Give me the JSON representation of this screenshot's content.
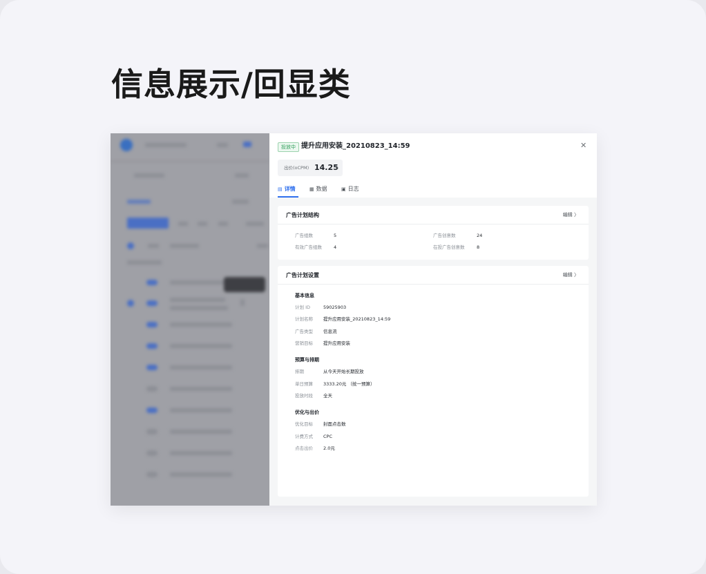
{
  "heading": "信息展示/回显类",
  "drawer": {
    "status_tag": "投放中",
    "title": "提升应用安装_20210823_14:59",
    "close_icon": "close-icon",
    "bid": {
      "label": "出价(oCPM)",
      "value": "14.25",
      "edit_icon": "pencil-icon"
    },
    "tabs": [
      {
        "label": "详情",
        "icon": "detail-icon",
        "active": true
      },
      {
        "label": "数据",
        "icon": "data-icon",
        "active": false
      },
      {
        "label": "日志",
        "icon": "log-icon",
        "active": false
      }
    ]
  },
  "structure": {
    "title": "广告计划结构",
    "edit_label": "编辑 〉",
    "items": [
      {
        "label": "广告组数",
        "value": "5"
      },
      {
        "label": "广告创意数",
        "value": "24"
      },
      {
        "label": "有效广告组数",
        "value": "4"
      },
      {
        "label": "在投广告创意数",
        "value": "8"
      }
    ]
  },
  "settings": {
    "title": "广告计划设置",
    "edit_label": "编辑 〉",
    "sections": [
      {
        "title": "基本信息",
        "rows": [
          {
            "label": "计划 ID",
            "value": "59025903"
          },
          {
            "label": "计划名称",
            "value": "提升应用安装_20210823_14:59"
          },
          {
            "label": "广告类型",
            "value": "信息流"
          },
          {
            "label": "营销目标",
            "value": "提升应用安装"
          }
        ]
      },
      {
        "title": "预算与排期",
        "rows": [
          {
            "label": "排期",
            "value": "从今天开始长期投放"
          },
          {
            "label": "单日预算",
            "value": "3333.20元 （统一预算）"
          },
          {
            "label": "投放时段",
            "value": "全天"
          }
        ]
      },
      {
        "title": "优化与出价",
        "rows": [
          {
            "label": "优化目标",
            "value": "封面点击数"
          },
          {
            "label": "计费方式",
            "value": "CPC"
          },
          {
            "label": "点击出价",
            "value": "2.0元"
          }
        ]
      }
    ]
  }
}
